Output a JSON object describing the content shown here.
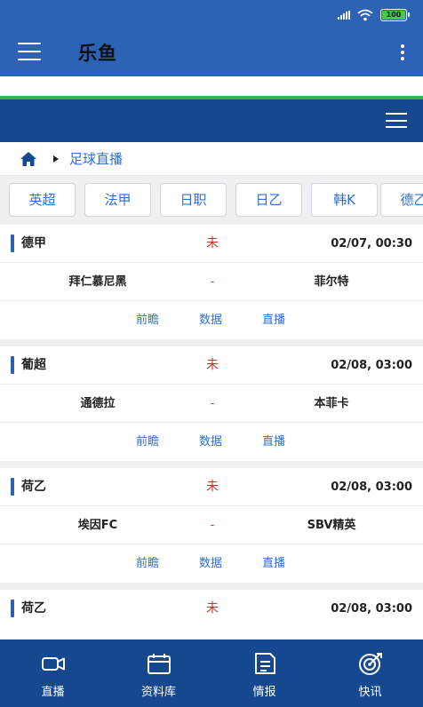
{
  "status_bar": {
    "battery": "100"
  },
  "app_bar": {
    "title": "乐鱼"
  },
  "page_load_progress": 1.0,
  "breadcrumb": {
    "current": "足球直播"
  },
  "league_tabs": [
    "英超",
    "法甲",
    "日职",
    "日乙",
    "韩K",
    "德乙"
  ],
  "matches": [
    {
      "league": "德甲",
      "status": "未",
      "time": "02/07, 00:30",
      "home": "拜仁慕尼黑",
      "score": "-",
      "away": "菲尔特",
      "links": [
        "前瞻",
        "数据",
        "直播"
      ]
    },
    {
      "league": "葡超",
      "status": "未",
      "time": "02/08, 03:00",
      "home": "通德拉",
      "score": "-",
      "away": "本菲卡",
      "links": [
        "前瞻",
        "数据",
        "直播"
      ]
    },
    {
      "league": "荷乙",
      "status": "未",
      "time": "02/08, 03:00",
      "home": "埃因FC",
      "score": "-",
      "away": "SBV精英",
      "links": [
        "前瞻",
        "数据",
        "直播"
      ]
    },
    {
      "league": "荷乙",
      "status": "未",
      "time": "02/08, 03:00"
    }
  ],
  "bottom_nav": [
    {
      "label": "直播",
      "icon": "video-camera-icon"
    },
    {
      "label": "资料库",
      "icon": "calendar-icon"
    },
    {
      "label": "情报",
      "icon": "document-icon"
    },
    {
      "label": "快讯",
      "icon": "target-icon"
    }
  ],
  "colors": {
    "app_bar": "#2c63b5",
    "header": "#16488f",
    "accent": "#2f6fcf",
    "status_red": "#c0392b",
    "progress": "#3fae49"
  }
}
